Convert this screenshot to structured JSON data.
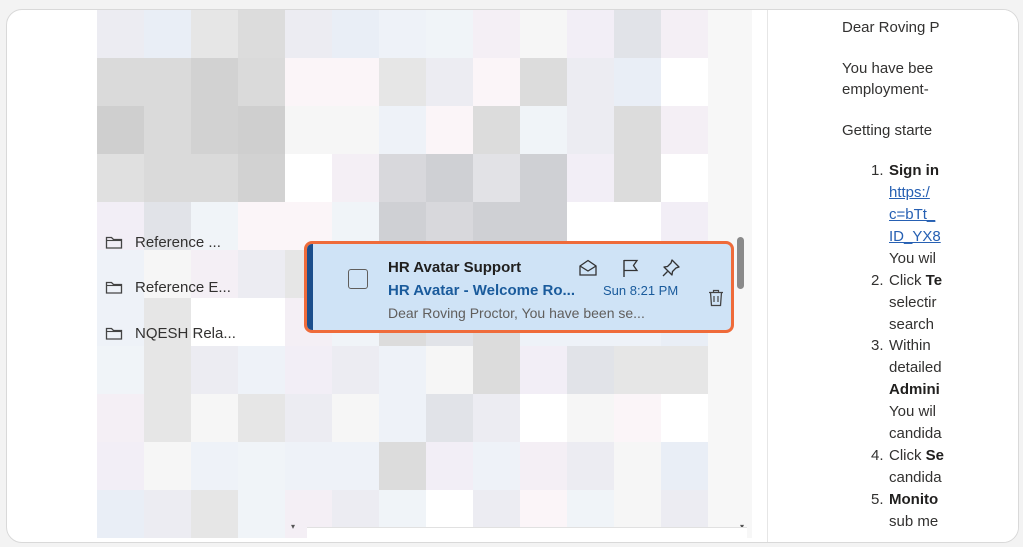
{
  "folders": [
    {
      "label": "Reference ..."
    },
    {
      "label": "Reference E..."
    },
    {
      "label": "NQESH Rela..."
    }
  ],
  "message": {
    "sender": "HR Avatar Support",
    "subject": "HR Avatar - Welcome Ro...",
    "time": "Sun 8:21 PM",
    "preview": "Dear Roving Proctor, You have been se...",
    "icons": [
      "envelope-open-icon",
      "flag-icon",
      "pin-icon",
      "trash-icon"
    ]
  },
  "reading": {
    "greeting": "Dear Roving P",
    "intro_1": "You have bee",
    "intro_2": "employment-",
    "getting_started": "Getting starte",
    "steps": {
      "s1_num": "1.",
      "s1_bold": "Sign in",
      "s1_link1": "https:/",
      "s1_link2": "c=bTt_",
      "s1_link3": "ID_YX8",
      "s1_text": "You wil",
      "s2_num": "2.",
      "s2_pre": "Click ",
      "s2_bold": "Te",
      "s2_l2": "selectir",
      "s2_l3": "search",
      "s3_num": "3.",
      "s3_l1": "Within",
      "s3_l2": "detailed",
      "s3_bold": "Admini",
      "s3_l4": "You wil",
      "s3_l5": "candida",
      "s4_num": "4.",
      "s4_pre": "Click ",
      "s4_bold": "Se",
      "s4_l2": "candida",
      "s5_num": "5.",
      "s5_bold": "Monito",
      "s5_l2": "sub me"
    }
  },
  "colors": {
    "selected_bg": "#cfe3f6",
    "highlight_border": "#ef6b3a",
    "accent_bar": "#1b4e8c",
    "link": "#2660b3"
  }
}
